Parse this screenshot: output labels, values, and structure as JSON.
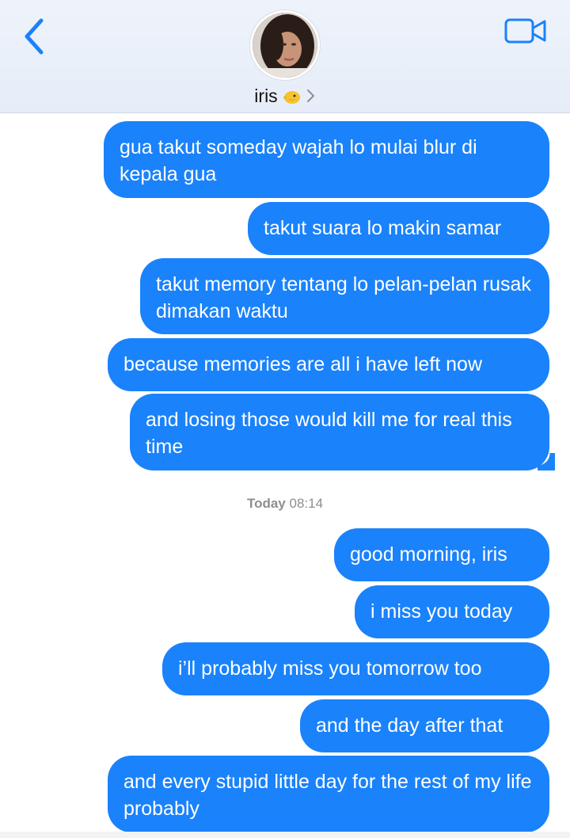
{
  "header": {
    "contact_name": "iris",
    "contact_emoji": "chick-emoji",
    "back_icon": "chevron-left-icon",
    "video_icon": "video-camera-icon",
    "accent_color": "#1a82fb"
  },
  "messages_before": [
    {
      "text": "gua takut someday wajah lo mulai blur di kepala gua"
    },
    {
      "text": "takut suara lo makin samar"
    },
    {
      "text": "takut memory tentang lo pelan-pelan rusak dimakan waktu"
    },
    {
      "text": "because memories are all i have left now"
    },
    {
      "text": "and losing those would kill me for real this time"
    }
  ],
  "timestamp": {
    "day": "Today",
    "time": "08:14"
  },
  "messages_after": [
    {
      "text": "good morning, iris"
    },
    {
      "text": "i miss you today"
    },
    {
      "text": "i’ll probably miss you tomorrow too"
    },
    {
      "text": "and the day after that"
    },
    {
      "text": "and every stupid little day for the rest of my life probably"
    }
  ]
}
